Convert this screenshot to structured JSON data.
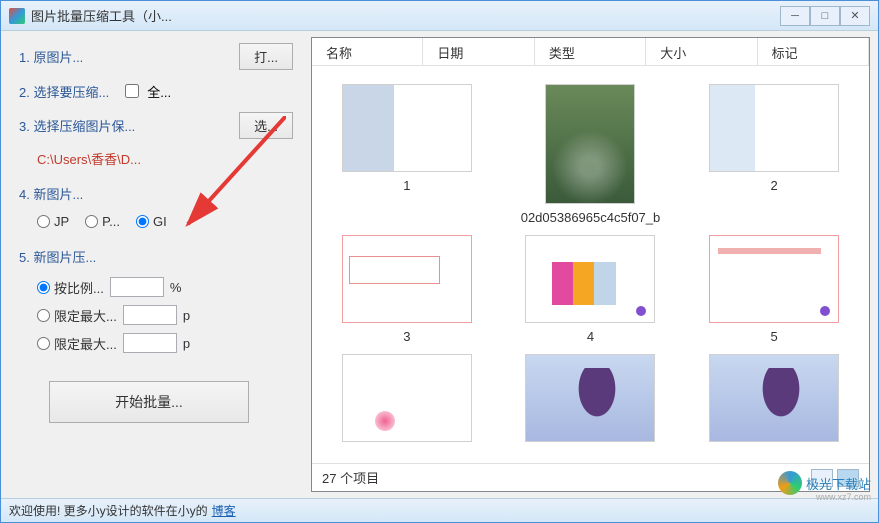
{
  "window": {
    "title": "图片批量压缩工具（小..."
  },
  "titlebar_buttons": {
    "min": "─",
    "max": "□",
    "close": "✕"
  },
  "sidebar": {
    "step1": {
      "label": "1. 原图片...",
      "button": "打..."
    },
    "step2": {
      "label": "2. 选择要压缩...",
      "checkbox_label": "全..."
    },
    "step3": {
      "label": "3. 选择压缩图片保...",
      "button": "选...",
      "path": "C:\\Users\\香香\\D..."
    },
    "step4": {
      "label": "4. 新图片...",
      "options": [
        {
          "label": "JP",
          "checked": false
        },
        {
          "label": "P...",
          "checked": false
        },
        {
          "label": "GI",
          "checked": true
        }
      ]
    },
    "step5": {
      "label": "5. 新图片压...",
      "rows": [
        {
          "label": "按比例...",
          "value": "",
          "unit": "%",
          "checked": true
        },
        {
          "label": "限定最大...",
          "value": "",
          "unit": "p",
          "checked": false
        },
        {
          "label": "限定最大...",
          "value": "",
          "unit": "p",
          "checked": false
        }
      ]
    },
    "start_button": "开始批量..."
  },
  "main": {
    "columns": [
      "名称",
      "日期",
      "类型",
      "大小",
      "标记"
    ],
    "items": [
      {
        "label": "1"
      },
      {
        "label": "02d05386965c4c5f07_b"
      },
      {
        "label": "2"
      },
      {
        "label": "3"
      },
      {
        "label": "4"
      },
      {
        "label": "5"
      }
    ],
    "status": "27 个项目"
  },
  "statusbar": {
    "text": "欢迎使用! 更多小y设计的软件在小y的",
    "link": "博客"
  },
  "watermark": {
    "text": "极光下载站",
    "url": "www.xz7.com"
  }
}
